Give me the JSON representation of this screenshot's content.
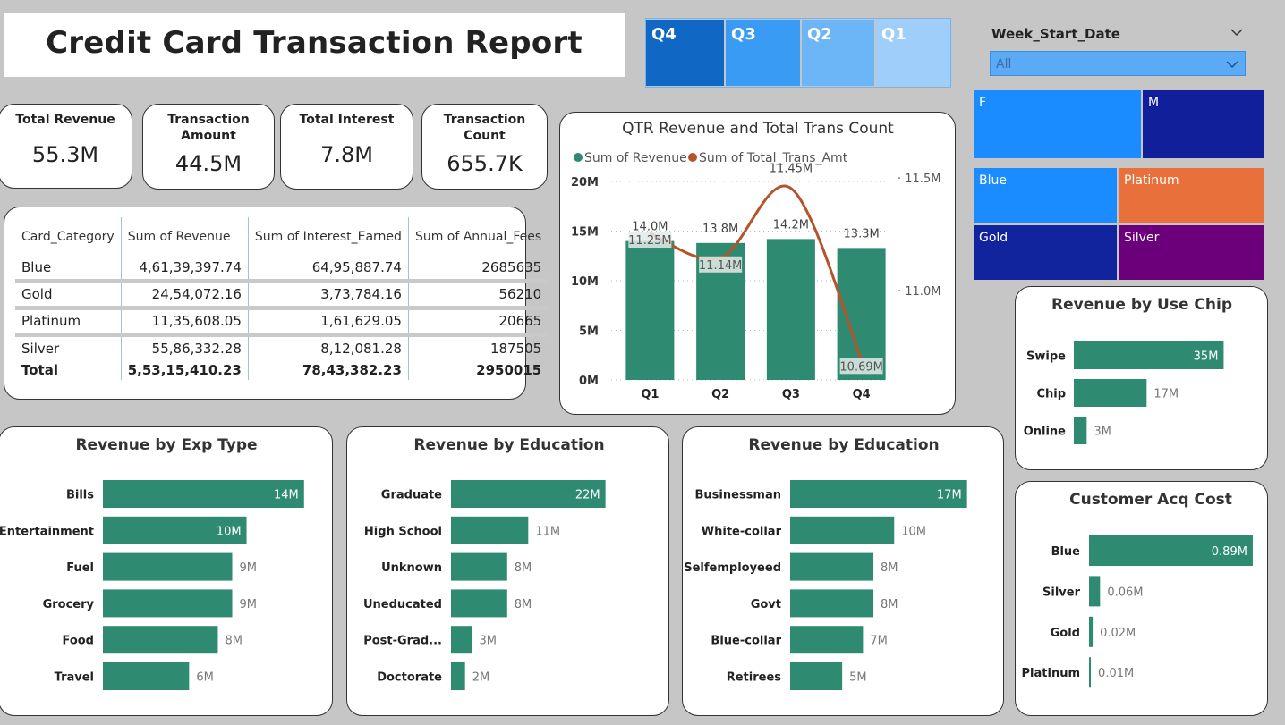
{
  "report_title": "Credit Card Transaction Report",
  "kpis": [
    {
      "label": "Total Revenue",
      "value": "55.3M"
    },
    {
      "label": "Transaction Amount",
      "value": "44.5M"
    },
    {
      "label": "Total Interest",
      "value": "7.8M"
    },
    {
      "label": "Transaction Count",
      "value": "655.7K"
    }
  ],
  "quarter_slicer": [
    "Q4",
    "Q3",
    "Q2",
    "Q1"
  ],
  "week_slicer": {
    "label": "Week_Start_Date",
    "value": "All"
  },
  "gender_tiles": [
    "F",
    "M"
  ],
  "card_tiles": [
    "Blue",
    "Platinum",
    "Gold",
    "Silver"
  ],
  "colors": {
    "bar": "#2e8b72",
    "line": "#b5532a",
    "q4": "#1168c4",
    "q3": "#3a9bf4",
    "q2": "#6cb6f8",
    "q1": "#9fcefa",
    "gender_f": "#1a8cff",
    "gender_m": "#11209a",
    "blue": "#1a8cff",
    "platinum": "#e8703a",
    "gold": "#12239e",
    "silver": "#6b007a"
  },
  "card_table": {
    "headers": [
      "Card_Category",
      "Sum of Revenue",
      "Sum of Interest_Earned",
      "Sum of Annual_Fees"
    ],
    "rows": [
      [
        "Blue",
        "4,61,39,397.74",
        "64,95,887.74",
        "2685635"
      ],
      [
        "Gold",
        "24,54,072.16",
        "3,73,784.16",
        "56210"
      ],
      [
        "Platinum",
        "11,35,608.05",
        "1,61,629.05",
        "20665"
      ],
      [
        "Silver",
        "55,86,332.28",
        "8,12,081.28",
        "187505"
      ]
    ],
    "total": [
      "Total",
      "5,53,15,410.23",
      "78,43,382.23",
      "2950015"
    ]
  },
  "chart_data": [
    {
      "type": "bar",
      "title": "QTR Revenue and Total Trans Count",
      "categories": [
        "Q1",
        "Q2",
        "Q3",
        "Q4"
      ],
      "series": [
        {
          "name": "Sum of Revenue",
          "type": "bar",
          "values": [
            14.0,
            13.8,
            14.2,
            13.3
          ],
          "labels": [
            "14.0M",
            "13.8M",
            "14.2M",
            "13.3M"
          ]
        },
        {
          "name": "Sum of Total_Trans_Amt",
          "type": "line",
          "values": [
            11.25,
            11.14,
            11.45,
            10.69
          ],
          "labels": [
            "11.25M",
            "11.14M",
            "11.45M",
            "10.69M"
          ]
        }
      ],
      "yticks": [
        "20M",
        "15M",
        "10M",
        "5M",
        "0M"
      ],
      "ylim": [
        0,
        20
      ],
      "y2ticks": [
        "11.5M",
        "11.0M"
      ],
      "y2lim": [
        10.6,
        11.48
      ],
      "legend": "top-left"
    },
    {
      "type": "bar",
      "orientation": "horizontal",
      "title": "Revenue by Use Chip",
      "categories": [
        "Swipe",
        "Chip",
        "Online"
      ],
      "values": [
        35,
        17,
        3
      ],
      "labels": [
        "35M",
        "17M",
        "3M"
      ],
      "xlim": [
        0,
        37
      ]
    },
    {
      "type": "bar",
      "orientation": "horizontal",
      "title": "Revenue by Exp Type",
      "categories": [
        "Bills",
        "Entertainment",
        "Fuel",
        "Grocery",
        "Food",
        "Travel"
      ],
      "values": [
        14,
        10,
        9,
        9,
        8,
        6
      ],
      "labels": [
        "14M",
        "10M",
        "9M",
        "9M",
        "8M",
        "6M"
      ],
      "xlim": [
        0,
        14.2
      ]
    },
    {
      "type": "bar",
      "orientation": "horizontal",
      "title": "Revenue by Education",
      "categories": [
        "Graduate",
        "High School",
        "Unknown",
        "Uneducated",
        "Post-Grad...",
        "Doctorate"
      ],
      "values": [
        22,
        11,
        8,
        8,
        3,
        2
      ],
      "labels": [
        "22M",
        "11M",
        "8M",
        "8M",
        "3M",
        "2M"
      ],
      "xlim": [
        0,
        22.3
      ]
    },
    {
      "type": "bar",
      "orientation": "horizontal",
      "title": "Revenue by Education",
      "categories": [
        "Businessman",
        "White-collar",
        "Selfemployeed",
        "Govt",
        "Blue-collar",
        "Retirees"
      ],
      "values": [
        17,
        10,
        8,
        8,
        7,
        5
      ],
      "labels": [
        "17M",
        "10M",
        "8M",
        "8M",
        "7M",
        "5M"
      ],
      "xlim": [
        0,
        17.2
      ]
    },
    {
      "type": "bar",
      "orientation": "horizontal",
      "title": "Customer Acq Cost",
      "categories": [
        "Blue",
        "Silver",
        "Gold",
        "Platinum"
      ],
      "values": [
        0.89,
        0.06,
        0.02,
        0.01
      ],
      "labels": [
        "0.89M",
        "0.06M",
        "0.02M",
        "0.01M"
      ],
      "xlim": [
        0,
        0.9
      ]
    }
  ]
}
